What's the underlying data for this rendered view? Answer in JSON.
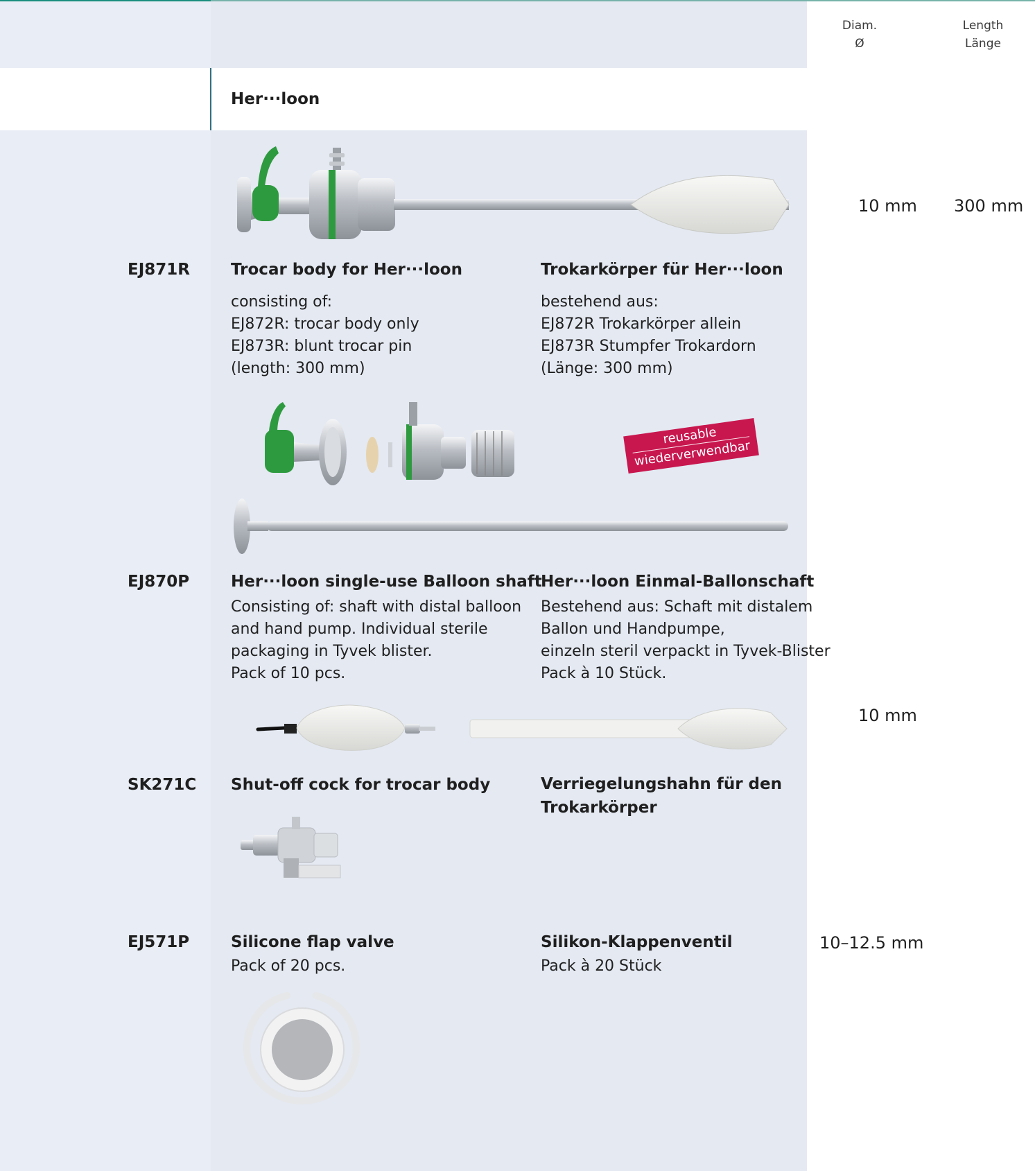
{
  "header": {
    "diam_label": "Diam.",
    "diam_symbol": "Ø",
    "length_label_en": "Length",
    "length_label_de": "Länge"
  },
  "section": {
    "title": "Her···loon"
  },
  "badge": {
    "line1": "reusable",
    "line2": "wiederverwendbar",
    "color": "#c8174f"
  },
  "products": [
    {
      "code": "EJ871R",
      "diam": "10 mm",
      "length": "300 mm",
      "title_en": "Trocar body for Her···loon",
      "lines_en": [
        "consisting of:",
        "EJ872R: trocar body only",
        "EJ873R: blunt trocar pin",
        "(length: 300 mm)"
      ],
      "title_de": "Trokarkörper für Her···loon",
      "lines_de": [
        "bestehend aus:",
        "EJ872R Trokarkörper allein",
        "EJ873R Stumpfer Trokardorn",
        "(Länge: 300 mm)"
      ]
    },
    {
      "code": "EJ870P",
      "diam": "10 mm",
      "title_en": "Her···loon single-use Balloon shaft",
      "lines_en": [
        "Consisting of: shaft with distal balloon",
        "and hand pump. Individual sterile",
        "packaging in Tyvek blister.",
        "Pack of 10 pcs."
      ],
      "title_de": "Her···loon Einmal-Ballonschaft",
      "lines_de": [
        "Bestehend aus: Schaft mit distalem",
        "Ballon und Handpumpe,",
        "einzeln steril verpackt in Tyvek-Blister",
        "Pack à 10 Stück."
      ]
    },
    {
      "code": "SK271C",
      "title_en": "Shut-off cock for trocar body",
      "title_de_lines": [
        "Verriegelungshahn für den",
        "Trokarkörper"
      ]
    },
    {
      "code": "EJ571P",
      "diam": "10–12.5 mm",
      "title_en": "Silicone flap valve",
      "lines_en": [
        "Pack of 20 pcs."
      ],
      "title_de": "Silikon-Klappenventil",
      "lines_de": [
        "Pack à 20 Stück"
      ]
    }
  ],
  "colors": {
    "accent": "#1a8f7e",
    "panel": "#e4e9f2",
    "green": "#2e9a3f"
  }
}
